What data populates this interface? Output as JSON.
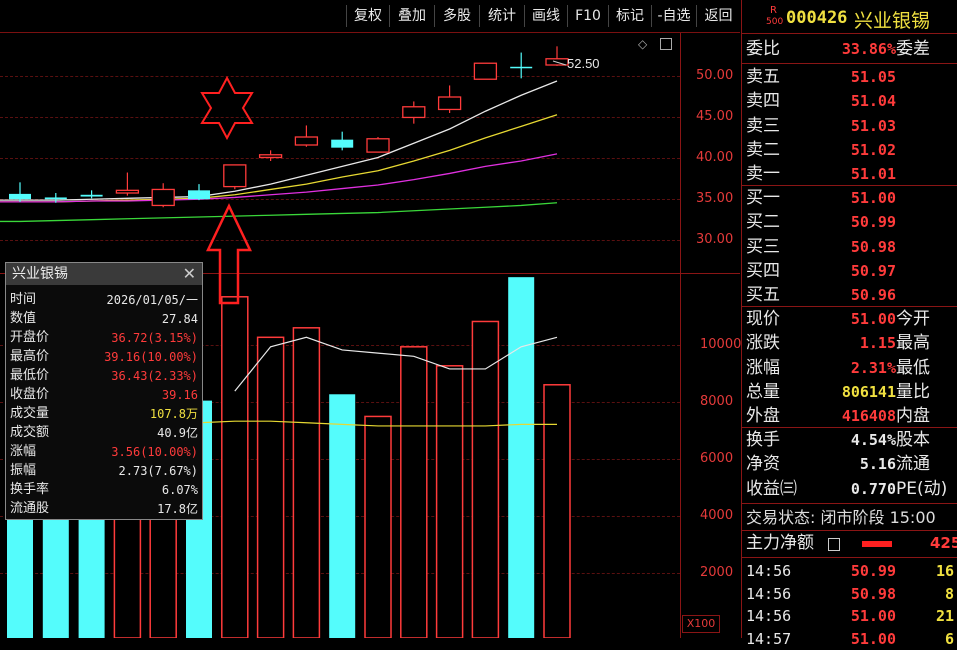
{
  "toolbar": {
    "buttons": [
      "复权",
      "叠加",
      "多股",
      "统计",
      "画线",
      "F10",
      "标记",
      "-自选",
      "返回"
    ]
  },
  "chart": {
    "price_ticks": [
      "50.00",
      "45.00",
      "40.00",
      "35.00",
      "30.00"
    ],
    "volume_ticks": [
      "10000",
      "8000",
      "6000",
      "4000",
      "2000"
    ],
    "high_marker": "52.50",
    "volume_unit": "X100",
    "settings_icon": "diamond-icon",
    "window_icon": "window-icon"
  },
  "chart_data": {
    "type": "candlestick",
    "price_axis": {
      "ylim": [
        27,
        54
      ],
      "ticks": [
        50,
        45,
        40,
        35,
        30
      ]
    },
    "volume_axis": {
      "ylim": [
        0,
        11500
      ],
      "ticks": [
        10000,
        8000,
        6000,
        4000,
        2000
      ]
    },
    "candles": [
      {
        "open": 35.3,
        "close": 35.9,
        "high": 37.2,
        "low": 35.0,
        "color": "cyan"
      },
      {
        "open": 35.3,
        "close": 35.5,
        "high": 36.0,
        "low": 34.9,
        "color": "cyan"
      },
      {
        "open": 35.6,
        "close": 35.8,
        "high": 36.3,
        "low": 35.4,
        "color": "cyan"
      },
      {
        "open": 36.0,
        "close": 36.3,
        "high": 38.3,
        "low": 35.7,
        "color": "red"
      },
      {
        "open": 34.6,
        "close": 36.4,
        "high": 37.1,
        "low": 34.4,
        "color": "red"
      },
      {
        "open": 36.3,
        "close": 35.3,
        "high": 37.0,
        "low": 35.2,
        "color": "cyan"
      },
      {
        "open": 36.72,
        "close": 39.16,
        "high": 39.16,
        "low": 36.43,
        "color": "red"
      },
      {
        "open": 40.0,
        "close": 40.3,
        "high": 40.8,
        "low": 39.6,
        "color": "red"
      },
      {
        "open": 41.4,
        "close": 42.3,
        "high": 43.6,
        "low": 41.2,
        "color": "red"
      },
      {
        "open": 42.0,
        "close": 41.1,
        "high": 42.9,
        "low": 40.8,
        "color": "cyan"
      },
      {
        "open": 40.6,
        "close": 42.1,
        "high": 42.3,
        "low": 40.6,
        "color": "red"
      },
      {
        "open": 44.5,
        "close": 45.7,
        "high": 46.3,
        "low": 43.8,
        "color": "red"
      },
      {
        "open": 45.4,
        "close": 46.8,
        "high": 48.1,
        "low": 45.0,
        "color": "red"
      },
      {
        "open": 48.8,
        "close": 50.6,
        "high": 50.6,
        "low": 48.8,
        "color": "red"
      },
      {
        "open": 50.2,
        "close": 50.2,
        "high": 51.8,
        "low": 48.9,
        "color": "cyan"
      },
      {
        "open": 50.4,
        "close": 51.1,
        "high": 52.5,
        "low": 50.3,
        "color": "red"
      }
    ],
    "ma_lines": [
      {
        "color": "#e8e8e8",
        "values": [
          35.2,
          35.2,
          35.3,
          35.4,
          35.5,
          35.6,
          36.2,
          37.0,
          38.0,
          39.0,
          40.0,
          41.6,
          43.2,
          45.2,
          47.0,
          48.6
        ]
      },
      {
        "color": "#e6d832",
        "values": [
          35.0,
          35.0,
          35.1,
          35.2,
          35.3,
          35.4,
          35.8,
          36.4,
          37.0,
          37.8,
          38.5,
          39.6,
          40.8,
          42.2,
          43.5,
          44.8
        ]
      },
      {
        "color": "#e030e0",
        "values": [
          35.0,
          35.0,
          35.1,
          35.1,
          35.2,
          35.3,
          35.5,
          35.8,
          36.1,
          36.5,
          36.9,
          37.5,
          38.2,
          39.0,
          39.6,
          40.4
        ]
      },
      {
        "color": "#3ad83a",
        "values": [
          32.8,
          32.9,
          33.0,
          33.1,
          33.2,
          33.3,
          33.4,
          33.5,
          33.6,
          33.7,
          33.8,
          34.0,
          34.2,
          34.4,
          34.6,
          34.9
        ]
      }
    ],
    "volumes": [
      {
        "value": 7200,
        "color": "cyan"
      },
      {
        "value": 6400,
        "color": "cyan"
      },
      {
        "value": 6300,
        "color": "cyan"
      },
      {
        "value": 6800,
        "color": "red"
      },
      {
        "value": 6300,
        "color": "red"
      },
      {
        "value": 7500,
        "color": "cyan"
      },
      {
        "value": 10780,
        "color": "red"
      },
      {
        "value": 9500,
        "color": "red"
      },
      {
        "value": 9800,
        "color": "red"
      },
      {
        "value": 7700,
        "color": "cyan"
      },
      {
        "value": 7000,
        "color": "red"
      },
      {
        "value": 9200,
        "color": "red"
      },
      {
        "value": 8600,
        "color": "red"
      },
      {
        "value": 10000,
        "color": "red"
      },
      {
        "value": 11400,
        "color": "cyan"
      },
      {
        "value": 8000,
        "color": "red"
      }
    ],
    "vol_ma_lines": [
      {
        "color": "#e8e8e8",
        "values": [
          null,
          null,
          null,
          null,
          null,
          null,
          7800,
          9200,
          9500,
          9100,
          9000,
          8900,
          8500,
          8500,
          9200,
          9500
        ]
      },
      {
        "color": "#e6d832",
        "values": [
          6800,
          6800,
          6800,
          6800,
          6800,
          6800,
          6850,
          6850,
          6800,
          6750,
          6700,
          6700,
          6700,
          6700,
          6750,
          6750
        ]
      }
    ]
  },
  "popup": {
    "title": "兴业银锡",
    "rows": [
      {
        "label": "时间",
        "value": "2026/01/05/一",
        "color": "#e8e8e8"
      },
      {
        "label": "数值",
        "value": "27.84",
        "color": "#e8e8e8"
      },
      {
        "label": "开盘价",
        "value": "36.72(3.15%)",
        "color": "#ff3b3b"
      },
      {
        "label": "最高价",
        "value": "39.16(10.00%)",
        "color": "#ff3b3b"
      },
      {
        "label": "最低价",
        "value": "36.43(2.33%)",
        "color": "#ff3b3b"
      },
      {
        "label": "收盘价",
        "value": "39.16",
        "color": "#ff3b3b"
      },
      {
        "label": "成交量",
        "value": "107.8万",
        "color": "#f0e040"
      },
      {
        "label": "成交额",
        "value": "40.9亿",
        "color": "#e8e8e8"
      },
      {
        "label": "涨幅",
        "value": "3.56(10.00%)",
        "color": "#ff3b3b"
      },
      {
        "label": "振幅",
        "value": "2.73(7.67%)",
        "color": "#e8e8e8"
      },
      {
        "label": "换手率",
        "value": "6.07%",
        "color": "#e8e8e8"
      },
      {
        "label": "流通股",
        "value": "17.8亿",
        "color": "#e8e8e8"
      }
    ]
  },
  "quote": {
    "badge_r": "R",
    "badge_num": "500",
    "code": "000426",
    "name": "兴业银锡",
    "weibi_label": "委比",
    "weibi_value": "33.86%",
    "weicha_label": "委差",
    "sell": [
      {
        "label": "卖五",
        "price": "51.05"
      },
      {
        "label": "卖四",
        "price": "51.04"
      },
      {
        "label": "卖三",
        "price": "51.03"
      },
      {
        "label": "卖二",
        "price": "51.02"
      },
      {
        "label": "卖一",
        "price": "51.01"
      }
    ],
    "buy": [
      {
        "label": "买一",
        "price": "51.00"
      },
      {
        "label": "买二",
        "price": "50.99"
      },
      {
        "label": "买三",
        "price": "50.98"
      },
      {
        "label": "买四",
        "price": "50.97"
      },
      {
        "label": "买五",
        "price": "50.96"
      }
    ],
    "stats": [
      {
        "label": "现价",
        "value": "51.00",
        "label2": "今开",
        "color": "#ff3b3b"
      },
      {
        "label": "涨跌",
        "value": "1.15",
        "label2": "最高",
        "color": "#ff3b3b"
      },
      {
        "label": "涨幅",
        "value": "2.31%",
        "label2": "最低",
        "color": "#ff3b3b"
      },
      {
        "label": "总量",
        "value": "806141",
        "label2": "量比",
        "color": "#f0e040"
      },
      {
        "label": "外盘",
        "value": "416408",
        "label2": "内盘",
        "color": "#ff3b3b"
      }
    ],
    "stats2": [
      {
        "label": "换手",
        "value": "4.54%",
        "label2": "股本",
        "color": "#e8e8e8"
      },
      {
        "label": "净资",
        "value": "5.16",
        "label2": "流通",
        "color": "#e8e8e8"
      },
      {
        "label": "收益㈢",
        "value": "0.770",
        "label2": "PE(动)",
        "color": "#e8e8e8"
      }
    ],
    "trade_status": "交易状态: 闭市阶段 15:00",
    "main_net_label": "主力净额",
    "main_net_value": "425",
    "trades": [
      {
        "time": "14:56",
        "price": "50.99",
        "vol": "16"
      },
      {
        "time": "14:56",
        "price": "50.98",
        "vol": "8"
      },
      {
        "time": "14:56",
        "price": "51.00",
        "vol": "21"
      },
      {
        "time": "14:57",
        "price": "51.00",
        "vol": "6"
      }
    ]
  }
}
